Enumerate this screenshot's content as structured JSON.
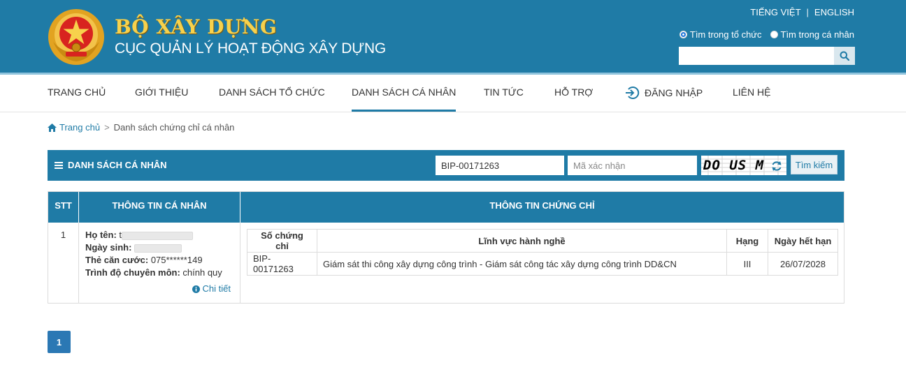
{
  "header": {
    "brand_title": "BỘ XÂY DỰNG",
    "brand_subtitle": "CỤC QUẢN LÝ HOẠT ĐỘNG XÂY DỰNG",
    "lang_vi": "TIẾNG VIỆT",
    "lang_sep": "|",
    "lang_en": "ENGLISH",
    "scope_org": "Tìm trong tổ chức",
    "scope_person": "Tìm trong cá nhân",
    "search_placeholder": ""
  },
  "nav": {
    "items": [
      {
        "label": "TRANG CHỦ"
      },
      {
        "label": "GIỚI THIỆU"
      },
      {
        "label": "DANH SÁCH TỔ CHỨC"
      },
      {
        "label": "DANH SÁCH CÁ NHÂN"
      },
      {
        "label": "TIN TỨC"
      },
      {
        "label": "HỖ TRỢ"
      },
      {
        "label": "ĐĂNG NHẬP"
      },
      {
        "label": "LIÊN HỆ"
      }
    ]
  },
  "breadcrumb": {
    "home": "Trang chủ",
    "sep": ">",
    "current": "Danh sách chứng chỉ cá nhân"
  },
  "section": {
    "title": "DANH SÁCH CÁ NHÂN",
    "cert_value": "BIP-00171263",
    "captcha_placeholder": "Mã xác nhận",
    "captcha_text": "DO US M",
    "search_label": "Tìm kiếm"
  },
  "table": {
    "headers": {
      "stt": "STT",
      "info": "THÔNG TIN CÁ NHÂN",
      "cert": "THÔNG TIN CHỨNG CHỈ"
    },
    "row": {
      "stt": "1",
      "name_label": "Họ tên:",
      "name_initial": "t",
      "dob_label": "Ngày sinh:",
      "id_label": "Thẻ căn cước:",
      "id_value": "075******149",
      "level_label": "Trình độ chuyên môn:",
      "level_value": "chính quy",
      "detail_label": "Chi tiết"
    },
    "cert_headers": {
      "number": "Số chứng chỉ",
      "field": "Lĩnh vực hành nghề",
      "grade": "Hạng",
      "expiry": "Ngày hết hạn"
    },
    "cert_row": {
      "number": "BIP-00171263",
      "field": "Giám sát thi công xây dựng công trình - Giám sát công tác xây dựng công trình DD&CN",
      "grade": "III",
      "expiry": "26/07/2028"
    }
  },
  "pagination": {
    "current": "1"
  },
  "colors": {
    "primary": "#1f7ba6",
    "gold": "#f7d14c",
    "page_button": "#2b78b4"
  }
}
